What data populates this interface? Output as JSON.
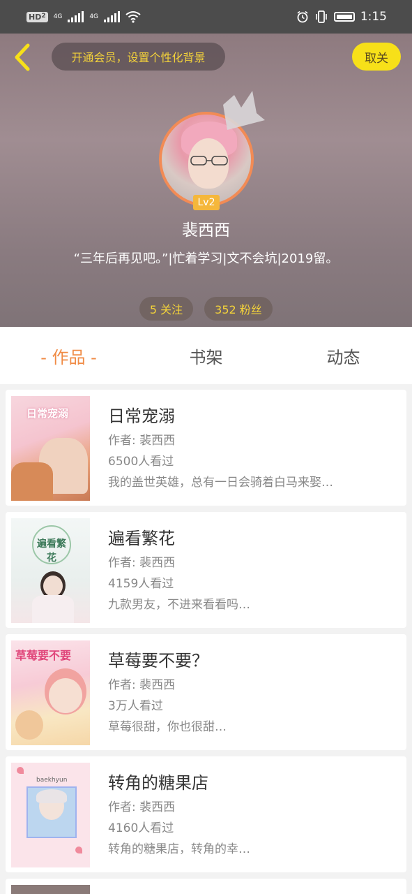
{
  "status_bar": {
    "left_badge": "HD",
    "left_badge_sub": "2",
    "network1": "4G",
    "network2": "4G",
    "time": "1:15"
  },
  "header": {
    "vip_prompt": "开通会员，设置个性化背景",
    "close_label": "取关",
    "level": "Lv2",
    "username": "裴西西",
    "bio": "“三年后再见吧。”|忙着学习|文不会坑|2019留。",
    "following": "5 关注",
    "followers": "352 粉丝"
  },
  "tabs": [
    {
      "label": "- 作品 -",
      "active": true
    },
    {
      "label": "书架",
      "active": false
    },
    {
      "label": "动态",
      "active": false
    }
  ],
  "works": [
    {
      "title": "日常宠溺",
      "author": "作者: 裴西西",
      "views": "6500人看过",
      "description": "我的盖世英雄，总有一日会骑着白马来娶…",
      "cover_text": "日常宠溺"
    },
    {
      "title": "遍看繁花",
      "author": "作者: 裴西西",
      "views": "4159人看过",
      "description": "九款男友，不进来看看吗…",
      "cover_text": "遍看繁花"
    },
    {
      "title": "草莓要不要？",
      "author": "作者: 裴西西",
      "views": "3万人看过",
      "description": "草莓很甜，你也很甜…",
      "cover_text": "草莓要不要"
    },
    {
      "title": "转角的糖果店",
      "author": "作者: 裴西西",
      "views": "4160人看过",
      "description": "转角的糖果店，转角的幸…",
      "cover_text": "baekhyun"
    }
  ],
  "icons": {
    "back": "chevron-left-icon",
    "crown": "crown-icon",
    "alarm": "alarm-icon",
    "vibrate": "vibrate-icon",
    "battery": "battery-icon",
    "wifi": "wifi-icon",
    "signal": "signal-icon"
  },
  "colors": {
    "accent_orange": "#f08b45",
    "accent_yellow": "#f7e019",
    "highlight_text": "#f3d23a"
  }
}
